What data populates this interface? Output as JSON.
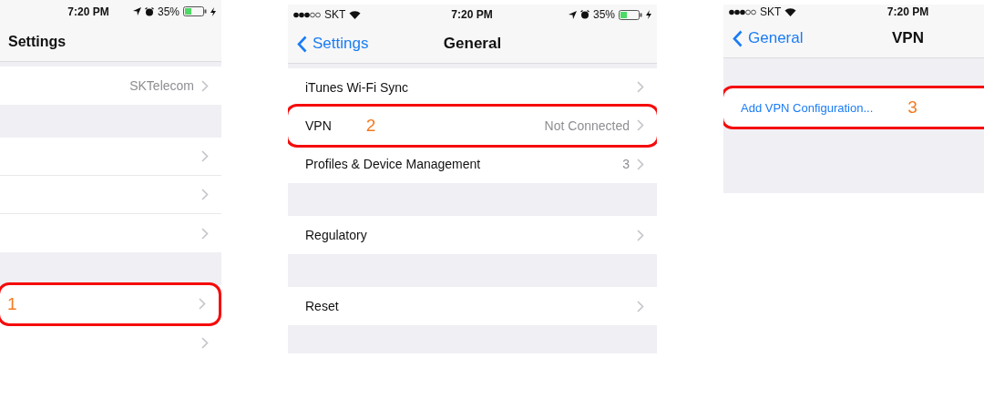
{
  "screens": [
    {
      "status_bar": {
        "time": "7:20 PM",
        "battery": "35%"
      },
      "nav": {
        "title": "Settings"
      },
      "groups": [
        {
          "rows": [
            {
              "kind": "item",
              "value": "SKTelecom",
              "highlighted": false
            }
          ]
        },
        {
          "rows": [
            {
              "kind": "item",
              "highlighted": false
            },
            {
              "kind": "item",
              "highlighted": false
            },
            {
              "kind": "item",
              "highlighted": false
            }
          ]
        },
        {
          "rows": [
            {
              "kind": "item",
              "highlighted": true,
              "callout": "1"
            },
            {
              "kind": "item",
              "highlighted": false
            }
          ]
        }
      ]
    },
    {
      "status_bar": {
        "carrier": "SKT",
        "time": "7:20 PM",
        "battery": "35%"
      },
      "nav": {
        "back": "Settings",
        "title": "General"
      },
      "groups": [
        {
          "rows": [
            {
              "kind": "item",
              "label": "iTunes Wi-Fi Sync",
              "highlighted": false
            },
            {
              "kind": "item",
              "label": "VPN",
              "value": "Not Connected",
              "highlighted": true,
              "callout": "2"
            },
            {
              "kind": "item",
              "label": "Profiles & Device Management",
              "value": "3",
              "highlighted": false
            }
          ]
        },
        {
          "rows": [
            {
              "kind": "item",
              "label": "Regulatory",
              "highlighted": false
            }
          ]
        },
        {
          "rows": [
            {
              "kind": "item",
              "label": "Reset",
              "highlighted": false
            }
          ]
        }
      ]
    },
    {
      "status_bar": {
        "carrier": "SKT",
        "time": "7:20 PM"
      },
      "nav": {
        "back": "General",
        "title": "VPN"
      },
      "groups": [
        {
          "rows": [
            {
              "kind": "action",
              "label": "Add VPN Configuration...",
              "highlighted": true,
              "callout": "3"
            }
          ]
        }
      ]
    }
  ]
}
